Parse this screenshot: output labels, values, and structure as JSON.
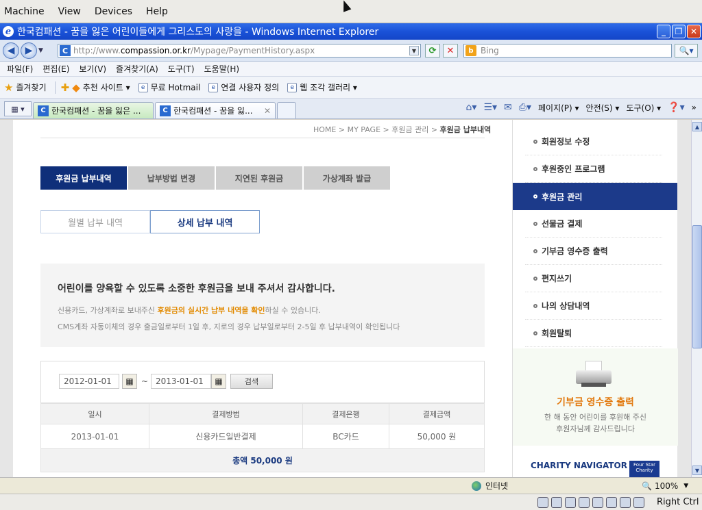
{
  "vbox": {
    "menu": [
      "Machine",
      "View",
      "Devices",
      "Help"
    ],
    "host_key": "Right Ctrl"
  },
  "ie": {
    "title": "한국컴패션 - 꿈을 잃은 어린이들에게 그리스도의 사랑을 - Windows Internet Explorer",
    "url_prefix": "http://www.",
    "url_domain": "compassion.or.kr",
    "url_path": "/Mypage/PaymentHistory.aspx",
    "search_placeholder": "Bing",
    "menu": [
      "파일(F)",
      "편집(E)",
      "보기(V)",
      "즐겨찾기(A)",
      "도구(T)",
      "도움말(H)"
    ],
    "favorites": {
      "label": "즐겨찾기",
      "items": [
        "추천 사이트 ▾",
        "무료 Hotmail",
        "연결 사용자 정의",
        "웹 조각 갤러리 ▾"
      ]
    },
    "tabs": [
      {
        "label": "한국컴패션 - 꿈을 잃은 ..."
      },
      {
        "label": "한국컴패션 - 꿈을 잃..."
      }
    ],
    "commands": {
      "page": "페이지(P) ▾",
      "safety": "안전(S) ▾",
      "tools": "도구(O) ▾"
    },
    "status": {
      "zone": "인터넷",
      "zoom": "100%"
    }
  },
  "page": {
    "breadcrumb": {
      "path": "HOME > MY PAGE > 후원금 관리 > ",
      "current": "후원금 납부내역"
    },
    "main_tabs": [
      "후원금 납부내역",
      "납부방법 변경",
      "지연된 후원금",
      "가상계좌 발급"
    ],
    "sub_tabs": [
      "월별 납부 내역",
      "상세 납부 내역"
    ],
    "notice": {
      "heading": "어린이를 양육할 수 있도록 소중한 후원금을 보내 주셔서 감사합니다.",
      "line1_pre": "신용카드, 가상계좌로 보내주신 ",
      "line1_hl": "후원금의 실시간 납부 내역을 확인",
      "line1_post": "하실 수 있습니다.",
      "line2": "CMS계좌 자동이체의 경우 출금일로부터 1일 후, 지로의 경우 납부일로부터 2-5일 후 납부내역이 확인됩니다"
    },
    "search": {
      "from": "2012-01-01",
      "to": "2013-01-01",
      "tilde": "~",
      "button": "검색"
    },
    "table": {
      "headers": [
        "일시",
        "결제방법",
        "결제은행",
        "결제금액"
      ],
      "rows": [
        [
          "2013-01-01",
          "신용카드일반결제",
          "BC카드",
          "50,000 원"
        ]
      ],
      "total": "총액 50,000 원"
    }
  },
  "sidebar": {
    "items": [
      "회원정보 수정",
      "후원중인 프로그램",
      "후원금 관리",
      "선물금 결제",
      "기부금 영수증 출력",
      "편지쓰기",
      "나의 상담내역",
      "회원탈퇴"
    ],
    "promo_title": "기부금 영수증 출력",
    "promo_line1": "한 해 동안 어린이를 후원해 주신",
    "promo_line2": "후원자님께 감사드립니다",
    "charity": "CHARITY NAVIGATOR",
    "four_star": "Four Star Charity"
  },
  "colors": {
    "accent_navy": "#0f2f7a",
    "highlight_orange": "#e28a00"
  }
}
